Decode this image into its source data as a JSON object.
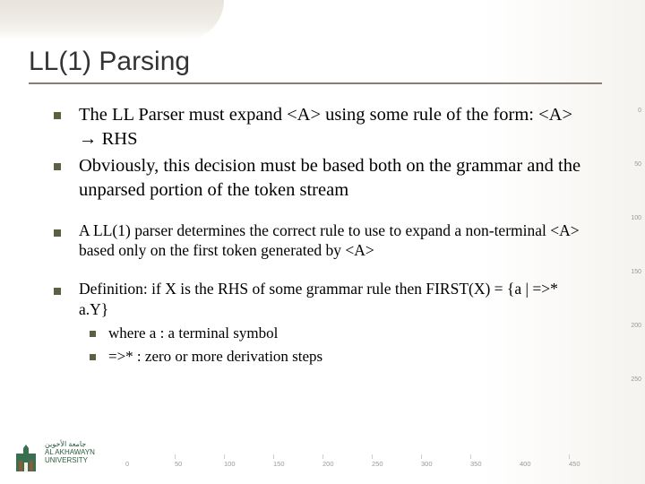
{
  "title": "LL(1) Parsing",
  "bullets": {
    "b1": "The LL Parser must expand <A> using some rule of the form: <A> → RHS",
    "b2": "Obviously, this decision must be based both on the grammar and the unparsed portion of the token stream",
    "b3": "A LL(1) parser determines the correct rule to use to expand a non-terminal <A> based only on the first token generated by <A>",
    "b4": "Definition: if X is the RHS of some grammar rule then FIRST(X) = {a | =>* a.Y}",
    "b4a": "where a : a terminal symbol",
    "b4b": "=>* : zero or more derivation steps"
  },
  "logo": {
    "line1": "جامعة الأخوين",
    "line2": "AL AKHAWAYN",
    "line3": "UNIVERSITY"
  },
  "ruler_bottom": [
    "0",
    "50",
    "100",
    "150",
    "200",
    "250",
    "300",
    "350",
    "400",
    "450"
  ],
  "ruler_right": [
    "0",
    "50",
    "100",
    "150",
    "200",
    "250"
  ]
}
